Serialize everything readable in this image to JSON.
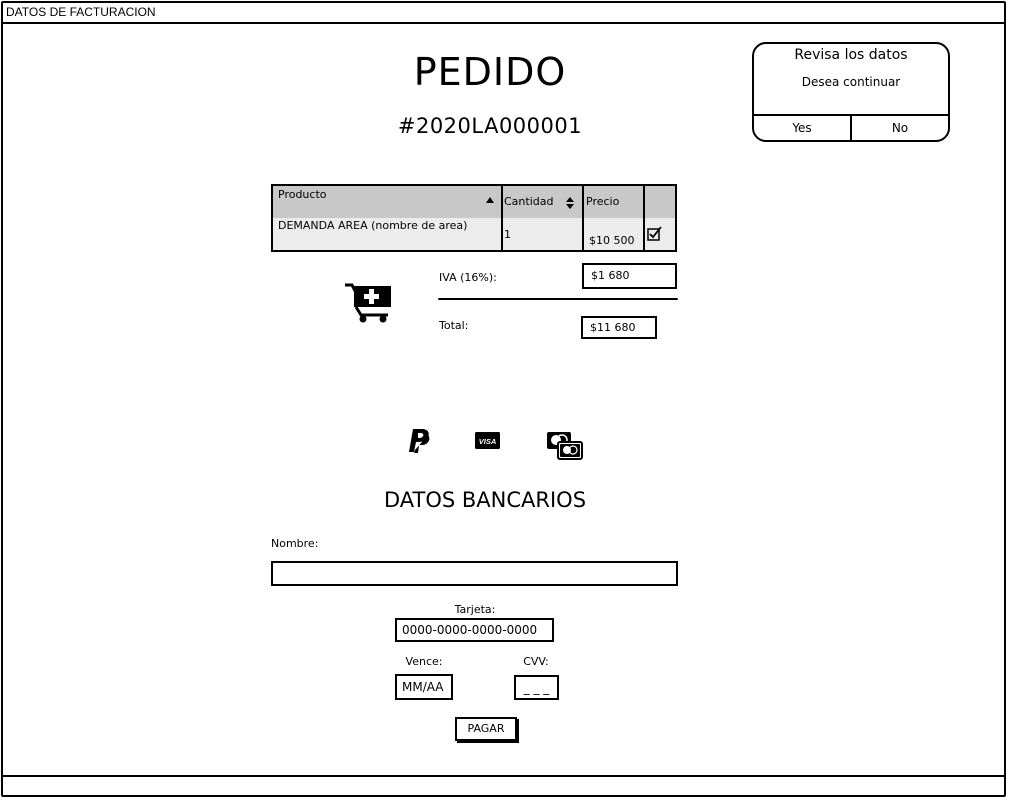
{
  "window": {
    "title": "DATOS DE FACTURACION"
  },
  "order": {
    "heading": "PEDIDO",
    "number": "#2020LA000001"
  },
  "dialog": {
    "title": "Revisa los datos",
    "message": "Desea continuar",
    "yes_label": "Yes",
    "no_label": "No"
  },
  "table": {
    "columns": [
      "Producto",
      "Cantidad",
      "Precio"
    ],
    "rows": [
      {
        "producto": "DEMANDA AREA (nombre de area)",
        "cantidad": "1",
        "precio": "$10 500",
        "checked": true
      }
    ]
  },
  "summary": {
    "iva_label": "IVA (16%):",
    "iva_value": "$1 680",
    "total_label": "Total:",
    "total_value": "$11 680"
  },
  "payment_icons": [
    "paypal-icon",
    "visa-icon",
    "mastercard-icon"
  ],
  "bank": {
    "heading": "DATOS BANCARIOS",
    "name_label": "Nombre:",
    "name_value": "",
    "card_label": "Tarjeta:",
    "card_value": "0000-0000-0000-0000",
    "expiry_label": "Vence:",
    "expiry_value": "MM/AA",
    "cvv_label": "CVV:",
    "cvv_value": "_ _ _",
    "pay_label": "PAGAR"
  }
}
